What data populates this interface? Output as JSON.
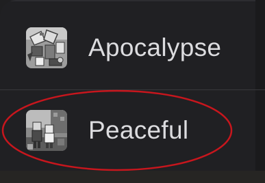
{
  "menu": {
    "items": [
      {
        "label": "Apocalypse",
        "icon": "apocalypse-mode-icon",
        "highlighted": false
      },
      {
        "label": "Peaceful",
        "icon": "peaceful-mode-icon",
        "highlighted": true
      }
    ]
  },
  "colors": {
    "background": "#202023",
    "text": "#dcdcdf",
    "divider": "#38383c",
    "highlight_ring": "#c8161d"
  }
}
